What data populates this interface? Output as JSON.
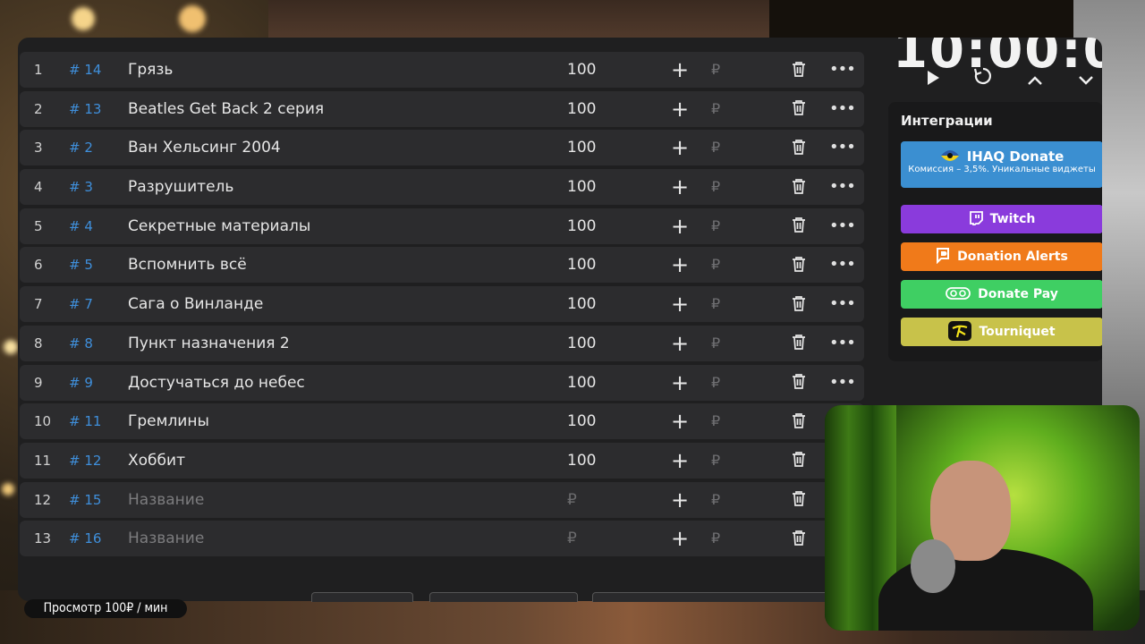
{
  "timer": {
    "text": "10:00:0"
  },
  "rows": [
    {
      "num": "1",
      "id": "# 14",
      "name": "Грязь",
      "amount": "100",
      "placeholder": false
    },
    {
      "num": "2",
      "id": "# 13",
      "name": "Beatles Get Back 2 серия",
      "amount": "100",
      "placeholder": false
    },
    {
      "num": "3",
      "id": "# 2",
      "name": "Ван Хельсинг 2004",
      "amount": "100",
      "placeholder": false
    },
    {
      "num": "4",
      "id": "# 3",
      "name": "Разрушитель",
      "amount": "100",
      "placeholder": false
    },
    {
      "num": "5",
      "id": "# 4",
      "name": "Секретные материалы",
      "amount": "100",
      "placeholder": false
    },
    {
      "num": "6",
      "id": "# 5",
      "name": "Вспомнить всё",
      "amount": "100",
      "placeholder": false
    },
    {
      "num": "7",
      "id": "# 7",
      "name": "Сага о Винланде",
      "amount": "100",
      "placeholder": false
    },
    {
      "num": "8",
      "id": "# 8",
      "name": "Пункт назначения 2",
      "amount": "100",
      "placeholder": false
    },
    {
      "num": "9",
      "id": "# 9",
      "name": "Достучаться до небес",
      "amount": "100",
      "placeholder": false
    },
    {
      "num": "10",
      "id": "# 11",
      "name": "Гремлины",
      "amount": "100",
      "placeholder": false
    },
    {
      "num": "11",
      "id": "# 12",
      "name": "Хоббит",
      "amount": "100",
      "placeholder": false
    },
    {
      "num": "12",
      "id": "# 15",
      "name": "Название",
      "amount": "₽",
      "placeholder": true
    },
    {
      "num": "13",
      "id": "# 16",
      "name": "Название",
      "amount": "₽",
      "placeholder": true
    }
  ],
  "row_icons": {
    "plus": "+",
    "currency": "₽",
    "more": "•••"
  },
  "integrations": {
    "title": "Интеграции",
    "ihaq_label": "IHAQ Donate",
    "ihaq_sub": "Комиссия – 3,5%. Уникальные виджеты",
    "twitch": "Twitch",
    "donation_alerts": "Donation Alerts",
    "donate_pay": "Donate Pay",
    "tourniquet": "Tourniquet",
    "colors": {
      "ihaq": "#3b8fd1",
      "twitch": "#8a3bdc",
      "donation_alerts": "#f07a1a",
      "donate_pay": "#3fcf63",
      "tourniquet": "#c8c24a"
    }
  },
  "view_badge": "Просмотр 100₽ / мин",
  "accent_color": "#3f8fdb"
}
